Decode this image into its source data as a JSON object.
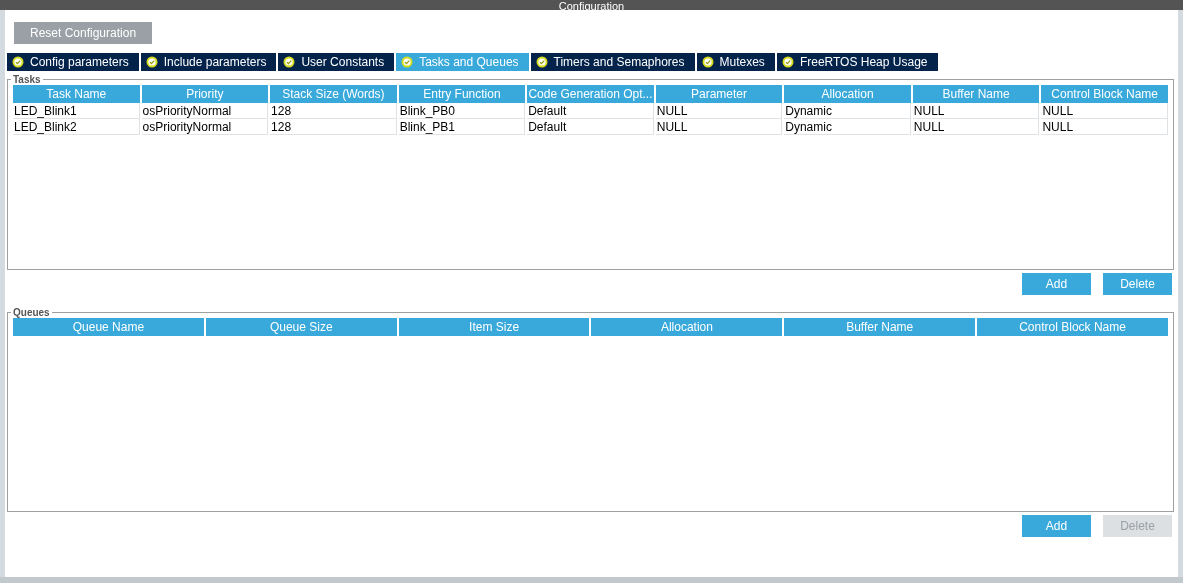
{
  "window": {
    "title": "Configuration"
  },
  "reset_button": {
    "label": "Reset Configuration"
  },
  "tabs": [
    {
      "label": "Config parameters",
      "selected": false
    },
    {
      "label": "Include parameters",
      "selected": false
    },
    {
      "label": "User Constants",
      "selected": false
    },
    {
      "label": "Tasks and Queues",
      "selected": true
    },
    {
      "label": "Timers and Semaphores",
      "selected": false
    },
    {
      "label": "Mutexes",
      "selected": false
    },
    {
      "label": "FreeRTOS Heap Usage",
      "selected": false
    }
  ],
  "sections": [
    {
      "title": "Tasks",
      "columns": [
        "Task Name",
        "Priority",
        "Stack Size (Words)",
        "Entry Function",
        "Code Generation Opt...",
        "Parameter",
        "Allocation",
        "Buffer Name",
        "Control Block Name"
      ],
      "rows": [
        [
          "LED_Blink1",
          "osPriorityNormal",
          "128",
          "Blink_PB0",
          "Default",
          "NULL",
          "Dynamic",
          "NULL",
          "NULL"
        ],
        [
          "LED_Blink2",
          "osPriorityNormal",
          "128",
          "Blink_PB1",
          "Default",
          "NULL",
          "Dynamic",
          "NULL",
          "NULL"
        ]
      ],
      "buttons": [
        {
          "label": "Add",
          "disabled": false
        },
        {
          "label": "Delete",
          "disabled": false
        }
      ]
    },
    {
      "title": "Queues",
      "columns": [
        "Queue Name",
        "Queue Size",
        "Item Size",
        "Allocation",
        "Buffer Name",
        "Control Block Name"
      ],
      "buttons": [
        {
          "label": "Add",
          "disabled": false
        },
        {
          "label": "Delete",
          "disabled": true
        }
      ]
    }
  ]
}
